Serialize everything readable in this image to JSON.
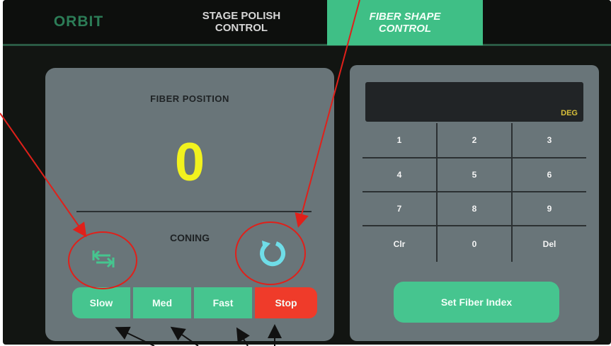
{
  "tabs": {
    "orbit": "ORBIT",
    "stage_polish": "STAGE POLISH\nCONTROL",
    "fiber_shape": "FIBER SHAPE\nCONTROL"
  },
  "left_panel": {
    "fiber_position_label": "FIBER POSITION",
    "fiber_position_value": "0",
    "mode_label": "CONING",
    "speed_buttons": [
      "Slow",
      "Med",
      "Fast",
      "Stop"
    ]
  },
  "right_panel": {
    "display_unit": "DEG",
    "keys": [
      "1",
      "2",
      "3",
      "4",
      "5",
      "6",
      "7",
      "8",
      "9",
      "Clr",
      "0",
      "Del"
    ],
    "set_button": "Set Fiber Index"
  },
  "icons": {
    "swap": "swap-arrows-icon",
    "refresh": "refresh-icon"
  },
  "colors": {
    "active_tab": "#3fbf86",
    "button_green": "#46c58f",
    "stop_red": "#ef3b2a",
    "value_yellow": "#f2f21e",
    "annotation_red": "#e0201a"
  }
}
